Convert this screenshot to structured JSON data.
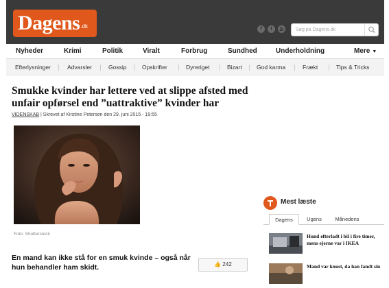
{
  "header": {
    "logo_text": "Dagens",
    "logo_tld": ".dk",
    "social": [
      "f",
      "t",
      "rss"
    ],
    "search_placeholder": "Søg på Dagens.dk"
  },
  "main_nav": {
    "items": [
      "Nyheder",
      "Krimi",
      "Politik",
      "Viralt",
      "Forbrug",
      "Sundhed",
      "Underholdning"
    ],
    "more_label": "Mere"
  },
  "sub_nav": {
    "items": [
      "Efterlysninger",
      "Advarsler",
      "Gossip",
      "Opskrifter",
      "Dyreriget",
      "Bizart",
      "God karma",
      "Frækt",
      "Tips & Tricks"
    ]
  },
  "article": {
    "headline": "Smukke kvinder har lettere ved at slippe afsted med unfair opførsel end ”uattraktive” kvinder har",
    "category": "VIDENSKAB",
    "byline": " | Skrevet af Kirstine Petersen den 29. juni 2015 - 19:55",
    "photo_caption": "Foto: Shutterstock",
    "lede": "En mand kan ikke stå for en smuk kvinde – også når hun behandler ham skidt.",
    "likes": "242"
  },
  "sidebar": {
    "title": "Mest læste",
    "tabs": [
      "Dagens",
      "Ugens",
      "Månedens"
    ],
    "active_tab": "Dagens",
    "stories": [
      "Hund efterladt i bil i fire timer, mens ejerne var i IKEA",
      "Mand var knust, da han fandt sin"
    ]
  },
  "colors": {
    "brand": "#e0581c",
    "header_bg": "#3a3a3a"
  }
}
